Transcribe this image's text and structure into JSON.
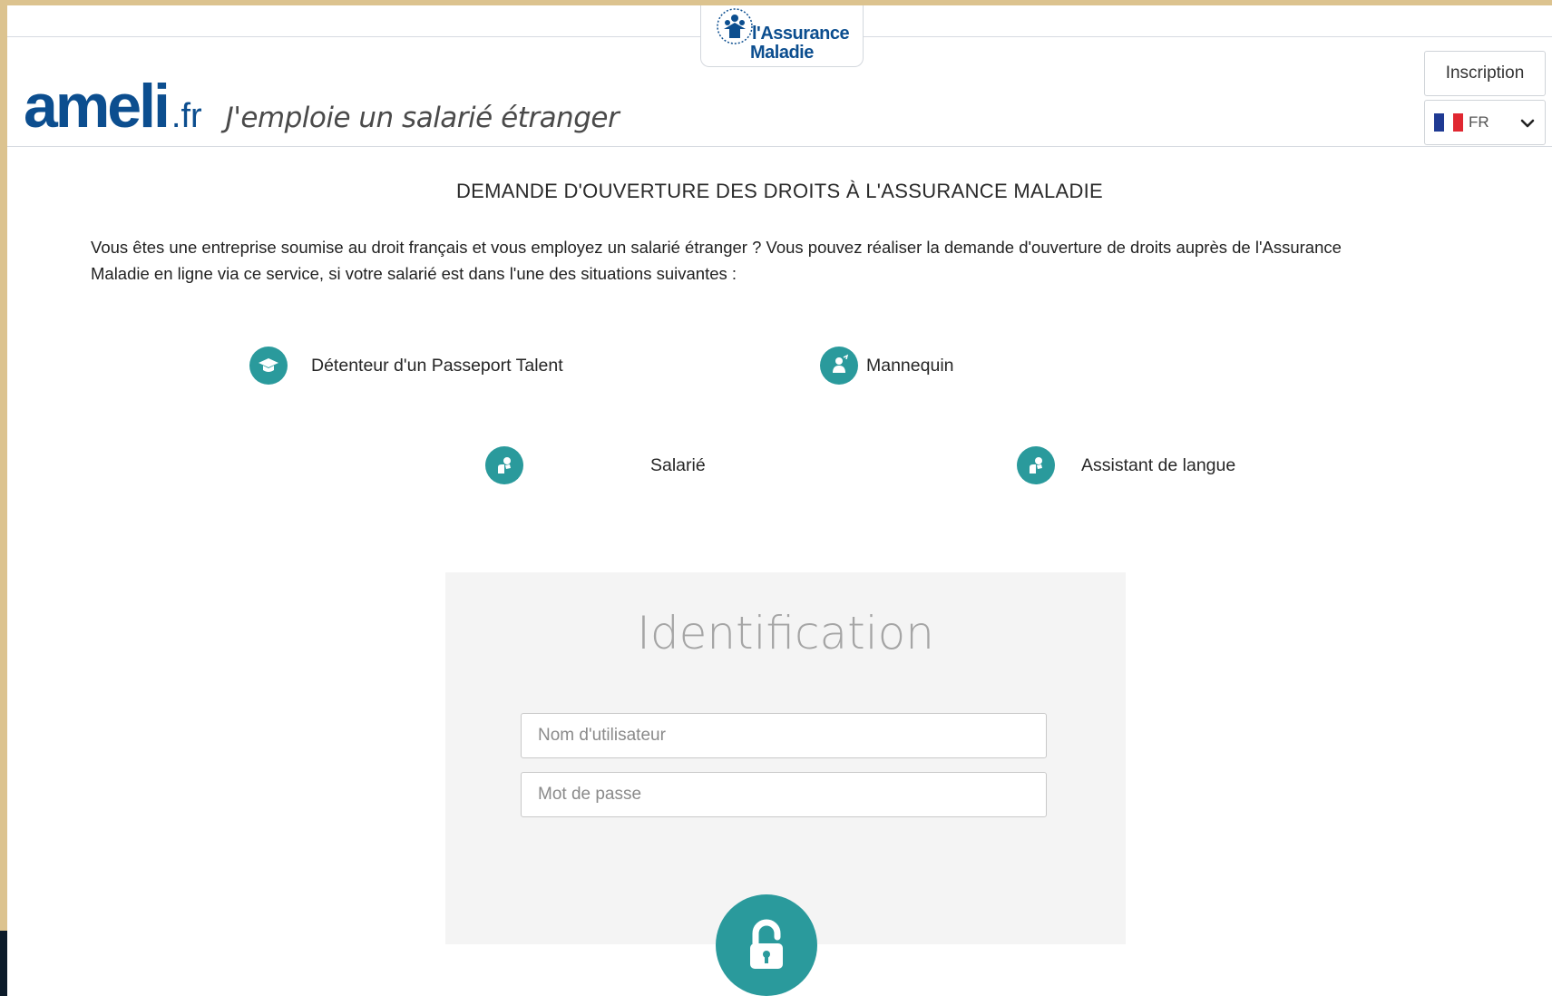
{
  "brand": {
    "line1": "l'Assurance",
    "line2": "Maladie"
  },
  "logo": {
    "main": "ameli",
    "tld": ".fr",
    "tagline": "J'emploie un salarié étranger"
  },
  "header": {
    "signup_label": "Inscription",
    "language": {
      "code": "FR",
      "flag_colors": [
        "#1f3a93",
        "#ffffff",
        "#e02731"
      ]
    }
  },
  "page": {
    "title": "DEMANDE D'OUVERTURE DES DROITS À L'ASSURANCE MALADIE",
    "intro": "Vous êtes une entreprise soumise au droit français et vous employez un salarié étranger ? Vous pouvez réaliser la demande d'ouverture de droits auprès de l'Assurance Maladie en ligne via ce service, si votre salarié est dans l'une des situations suivantes :"
  },
  "situations": [
    {
      "label": "Détenteur d'un Passeport Talent",
      "icon": "graduation-cap-icon"
    },
    {
      "label": "Mannequin",
      "icon": "model-icon"
    },
    {
      "label": "Salarié",
      "icon": "employee-icon"
    },
    {
      "label": "Assistant de langue",
      "icon": "language-assistant-icon"
    }
  ],
  "login": {
    "title": "Identification",
    "username_placeholder": "Nom d'utilisateur",
    "username_value": "",
    "password_placeholder": "Mot de passe",
    "password_value": "",
    "submit_icon": "unlock-icon"
  },
  "colors": {
    "brand_blue": "#0c4e8f",
    "accent_teal": "#2a9a9c",
    "frame": "#dcc38f"
  }
}
